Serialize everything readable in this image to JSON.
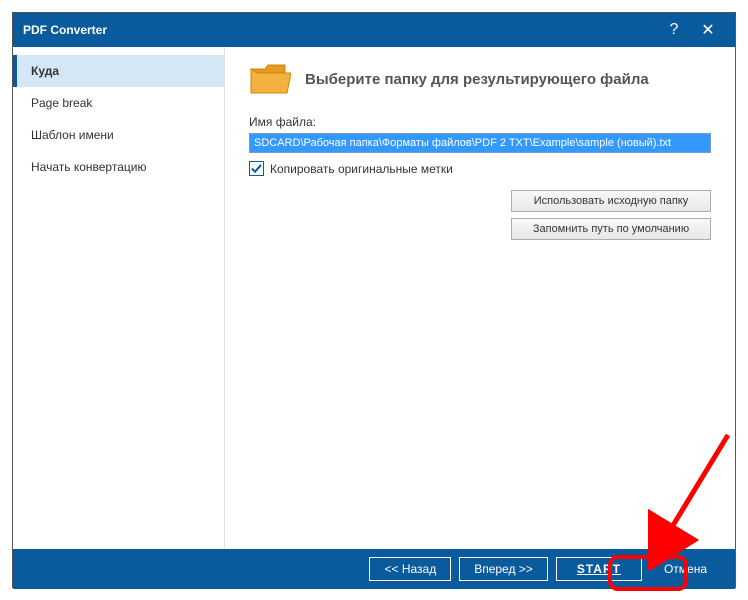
{
  "titlebar": {
    "title": "PDF Converter"
  },
  "sidebar": {
    "items": [
      {
        "label": "Куда"
      },
      {
        "label": "Page break"
      },
      {
        "label": "Шаблон имени"
      },
      {
        "label": "Начать конвертацию"
      }
    ]
  },
  "main": {
    "heading": "Выберите папку для результирующего файла",
    "filename_label": "Имя файла:",
    "filename_value": "SDCARD\\Рабочая папка\\Форматы файлов\\PDF 2 TXT\\Example\\sample (новый).txt",
    "checkbox_label": "Копировать оригинальные метки",
    "btn_use_source": "Использовать исходную папку",
    "btn_remember_default": "Запомнить путь по умолчанию"
  },
  "footer": {
    "back": "<< Назад",
    "next": "Вперед >>",
    "start": "START",
    "cancel": "Отмена"
  }
}
